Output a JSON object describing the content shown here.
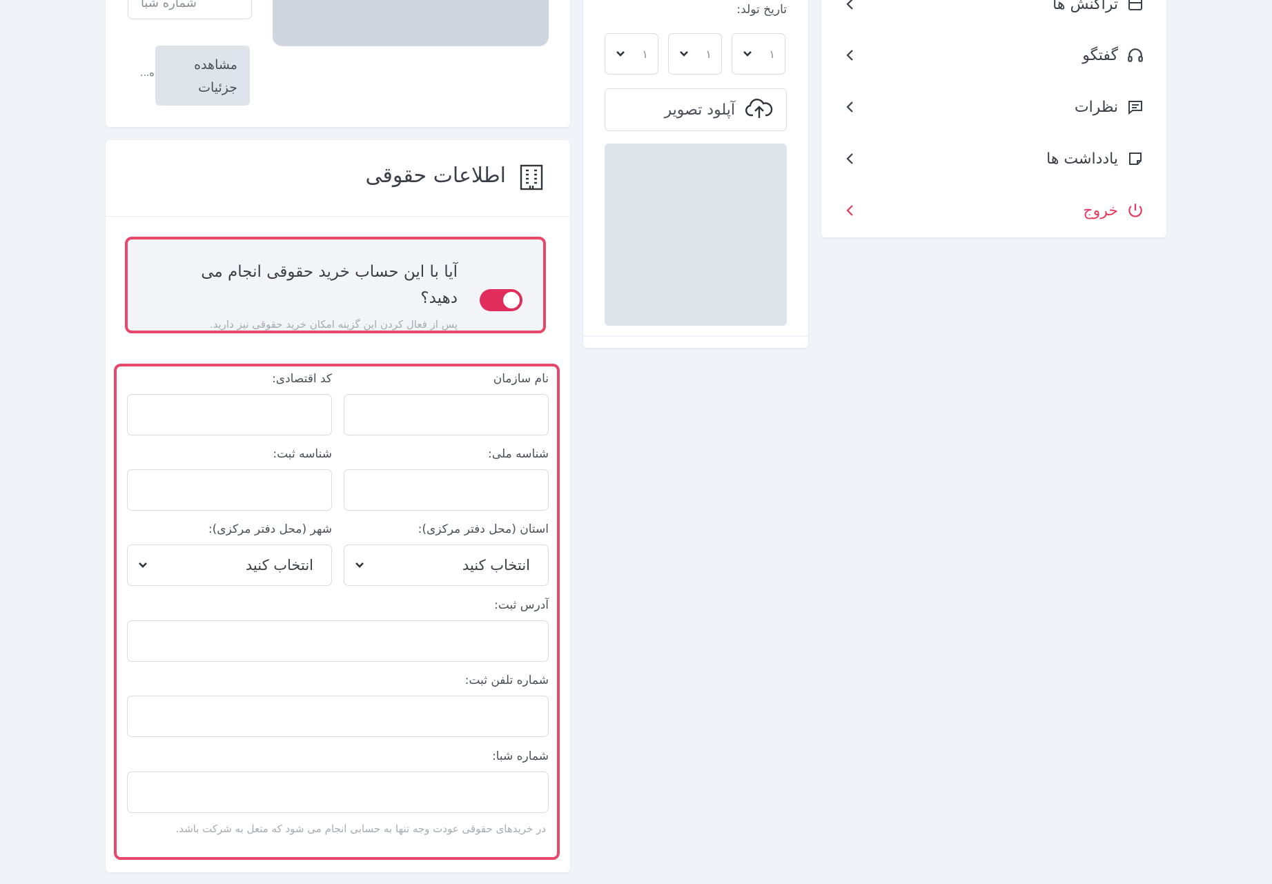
{
  "sidebar": {
    "items": [
      {
        "label": "تراکنش ها",
        "icon": "wallet-icon"
      },
      {
        "label": "گفتگو",
        "icon": "headset-icon"
      },
      {
        "label": "نظرات",
        "icon": "comment-icon"
      },
      {
        "label": "یادداشت ها",
        "icon": "note-icon"
      },
      {
        "label": "خروج",
        "icon": "power-icon"
      }
    ],
    "danger_color": "#e53a5f"
  },
  "profile": {
    "dob_label": "تاریخ تولد:",
    "dob_day": "۱",
    "dob_month": "۱",
    "dob_year": "۱",
    "upload_label": "آپلود تصویر"
  },
  "top_card": {
    "field_partial": "شماره شبا",
    "details_label": "مشاهده جزئیات",
    "ellipsis": "...ه"
  },
  "legal": {
    "title": "اطلاعات حقوقی",
    "toggle_question": "آیا با این حساب خرید حقوقی انجام می دهید؟",
    "toggle_hint": "پس از فعال کردن این گزینه امکان خرید حقوقی نیز دارید.",
    "toggle_on": true,
    "accent_color": "#e02d5b",
    "fields": {
      "org_name": "نام سازمان",
      "economic_code": "کد اقتصادی:",
      "national_id": "شناسه ملی:",
      "registration_id": "شناسه ثبت:",
      "province": "استان (محل دفتر مرکزی):",
      "city": "شهر (محل دفتر مرکزی):",
      "select_placeholder": "انتخاب کنید",
      "address": "آدرس ثبت:",
      "phone": "شماره تلفن ثبت:",
      "sheba": "شماره شبا:"
    },
    "note": "در خریدهای حقوقی عودت وجه تنها به حسابی انجام می شود که متعل به شرکت باشد."
  }
}
